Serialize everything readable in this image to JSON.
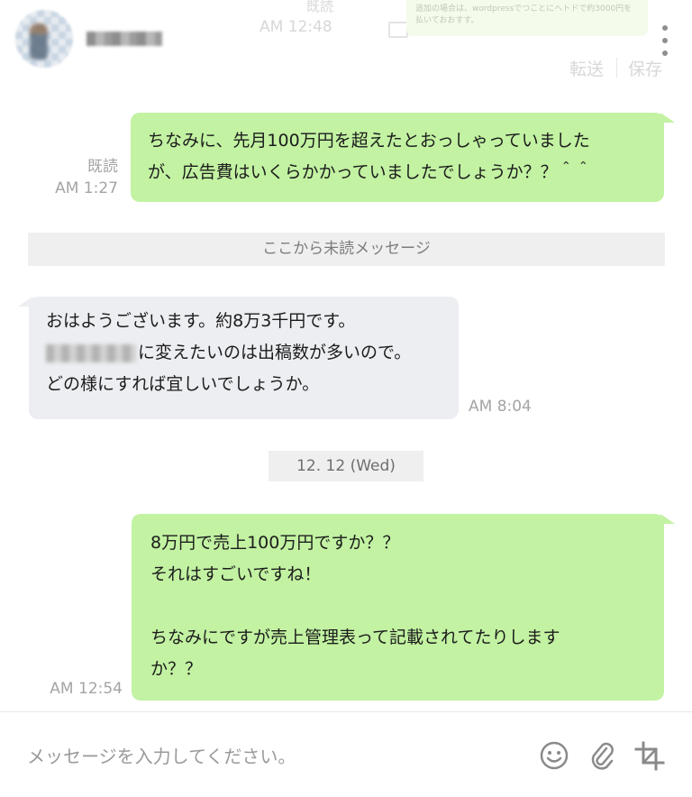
{
  "header": {
    "faded_status": "既読",
    "faded_time": "AM 12:48",
    "faded_card_text": "追加の場合は、wordpressでつことにへトドで約3000円を払いておおすす。",
    "forward_label": "転送",
    "save_label": "保存",
    "more_icon": "kebab-vertical-icon"
  },
  "messages": {
    "m1": {
      "line1": "ちなみに、先月100万円を超えたとおっしゃっていました",
      "line2": "が、広告費はいくらかかっていましたでしょうか？？＾＾",
      "status": "既読",
      "time": "AM 1:27"
    },
    "unread_divider": "ここから未読メッセージ",
    "m2": {
      "line1": "おはようございます。約8万3千円です。",
      "line2_suffix": "に変えたいのは出稿数が多いので。",
      "line3": "どの様にすれば宜しいでしょうか。",
      "time": "AM 8:04"
    },
    "date_label": "12. 12 (Wed)",
    "m3": {
      "line1": "8万円で売上100万円ですか？？",
      "line2": "それはすごいですね！",
      "line3": "ちなみにですが売上管理表って記載されてたりします",
      "line4": "か？？",
      "time": "AM 12:54"
    }
  },
  "composer": {
    "placeholder": "メッセージを入力してください。",
    "icons": [
      "smiley-icon",
      "paperclip-icon",
      "crop-icon"
    ]
  },
  "colors": {
    "outgoing_bubble": "#c2f2a2",
    "incoming_bubble": "#edeef2",
    "meta_text": "#a4a4a4",
    "divider_bg": "#efefef"
  }
}
